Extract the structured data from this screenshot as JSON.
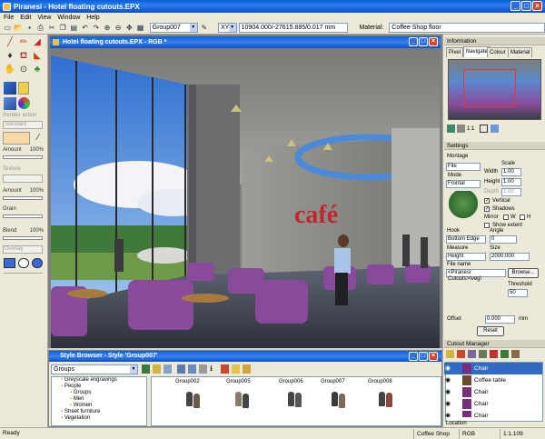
{
  "app": {
    "title": "Piranesi - Hotel floating cutouts.EPX"
  },
  "menu": [
    "File",
    "Edit",
    "View",
    "Window",
    "Help"
  ],
  "toolbar": {
    "group_value": "Group007",
    "axis_value": "XYZ",
    "coords_value": "10904.000/-27615.885/0.017 mm",
    "material_label": "Material:",
    "material_value": "Coffee Shop floor"
  },
  "left_panel": {
    "amount_label": "Amount",
    "amount_value": "100%",
    "texture_label": "Texture",
    "amount2_label": "Amount",
    "amount2_value": "100%",
    "grain_label": "Grain",
    "blend_label": "Blend",
    "blend_value": "100%",
    "render_action_label": "Render action",
    "render_action_value": "Standard",
    "overlay_value": "Overlay"
  },
  "viewport": {
    "title": "Hotel floating cutouts.EPX - RGB *",
    "sign_text": "café"
  },
  "right_panel": {
    "information_header": "Information",
    "tabs": [
      "Pixel",
      "Navigate",
      "Colour",
      "Material"
    ],
    "active_tab": "Navigate",
    "zoom_readout": "1:1",
    "settings_header": "Settings",
    "montage_label": "Montage",
    "file_combo": "File",
    "mode_label": "Mode",
    "mode_value": "Frontal",
    "scale_label": "Scale",
    "width_label": "Width",
    "width_value": "1.00",
    "height_label": "Height",
    "height_value": "1.00",
    "depth_label": "Depth",
    "depth_value": "1.00",
    "vertical_label": "Vertical",
    "shadows_label": "Shadows",
    "mirror_label": "Mirror",
    "mirror_w": "W",
    "mirror_h": "H",
    "show_extent_label": "Show extent",
    "hook_label": "Hook",
    "hook_value": "Bottom Edge",
    "angle_label": "Angle",
    "angle_value": "0",
    "measure_label": "Measure",
    "measure_value": "Height",
    "size_label": "Size",
    "size_value": "2000.000",
    "filename_label": "File name",
    "filename_value": "<Piranesi Cutouts>\\veg\\",
    "browse_label": "Browse...",
    "threshold_label": "Threshold",
    "threshold_value": "50",
    "offset_label": "Offset",
    "offset_value": "0.000",
    "offset_unit": "mm",
    "reset_label": "Reset",
    "cutout_manager_header": "Cutout Manager",
    "cutouts": [
      "Chair",
      "Coffee table",
      "Chair",
      "Chair",
      "Chair"
    ],
    "location_label": "Location"
  },
  "style_browser": {
    "title": "Style Browser - Style 'Group007'",
    "category_value": "Groups",
    "tree": [
      {
        "label": "Greyscale engravings",
        "indent": 1
      },
      {
        "label": "People",
        "indent": 1
      },
      {
        "label": "Groups",
        "indent": 2
      },
      {
        "label": "Men",
        "indent": 2
      },
      {
        "label": "Women",
        "indent": 2
      },
      {
        "label": "Street furniture",
        "indent": 1
      },
      {
        "label": "Vegetation",
        "indent": 1
      }
    ],
    "thumbnails": [
      "Group002",
      "Group005",
      "Group006",
      "Group007",
      "Group008"
    ]
  },
  "status": {
    "ready": "Ready",
    "material": "Coffee Shop floor",
    "mode": "RGB",
    "zoom": "1:1.109"
  },
  "colors": {
    "titlebar": "#0b4fc4",
    "chrome": "#ece9d8",
    "chair": "#8a4a9c",
    "cafe_sign": "#c0272d"
  }
}
